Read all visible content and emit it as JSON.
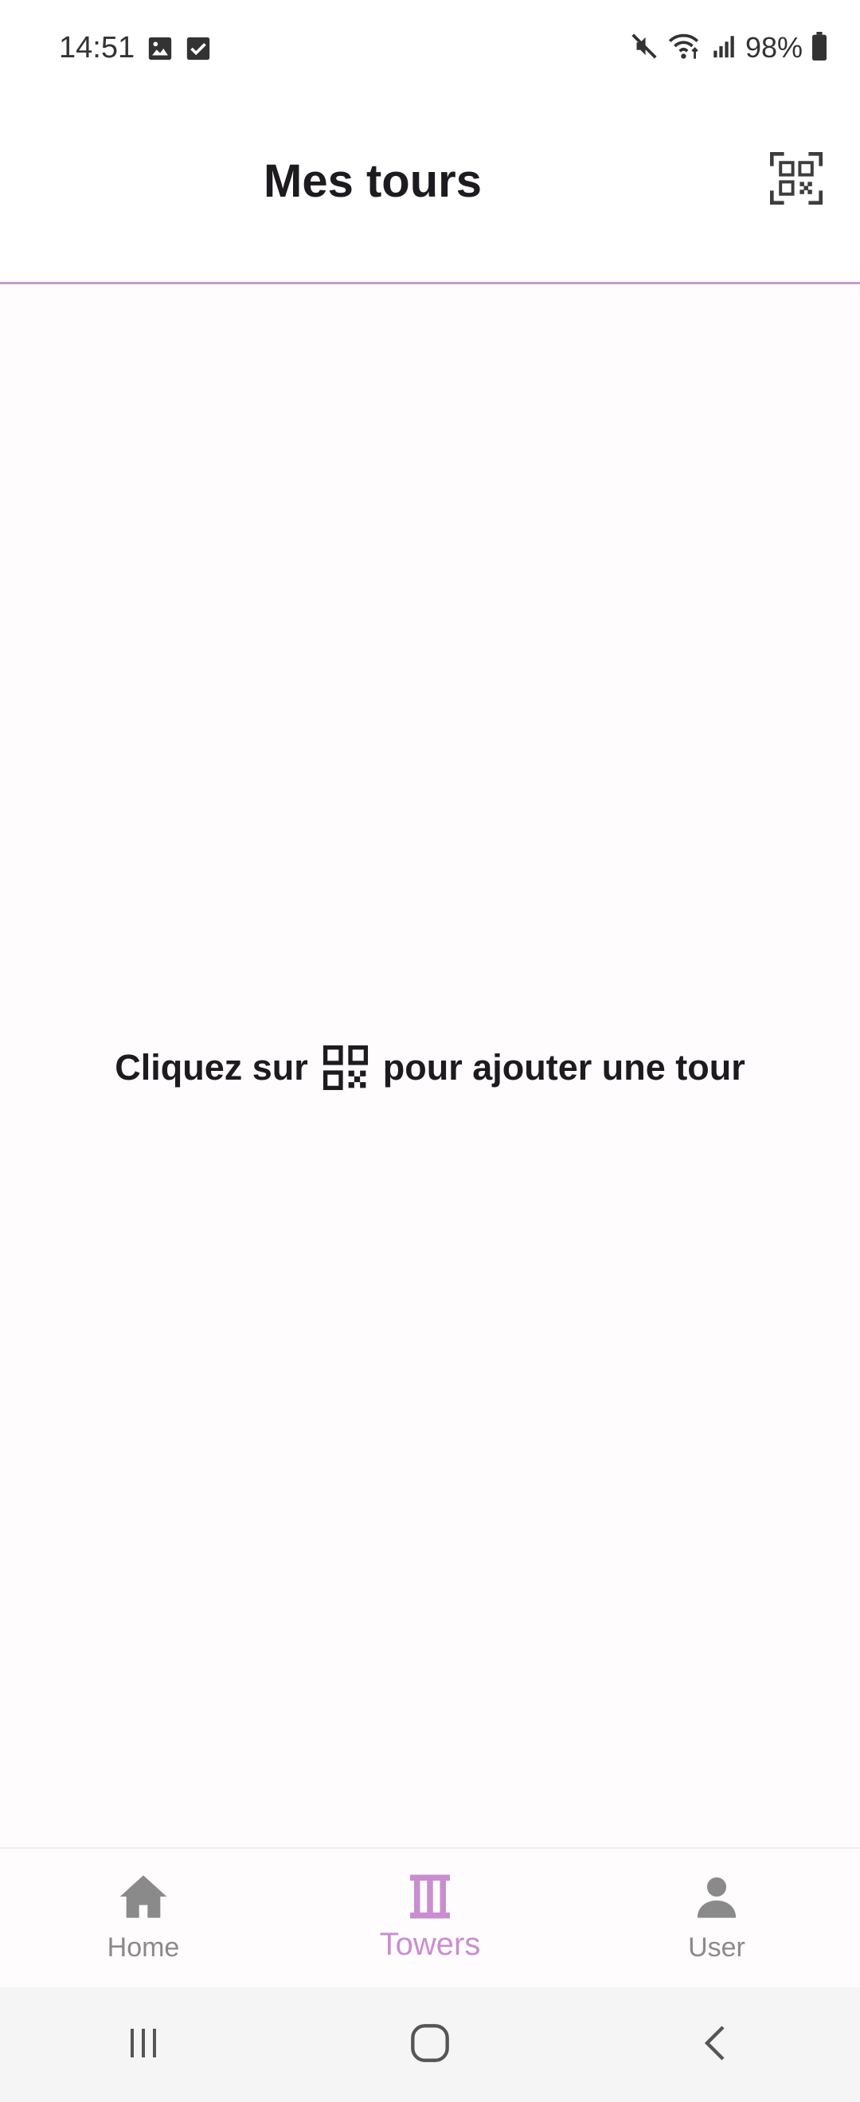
{
  "status_bar": {
    "time": "14:51",
    "battery_percent": "98%",
    "icons": [
      "gallery-notification-icon",
      "checkbox-notification-icon",
      "mute-icon",
      "wifi-icon",
      "signal-icon",
      "battery-icon"
    ]
  },
  "app_bar": {
    "title": "Mes tours",
    "scan_icon": "qr-scan-icon"
  },
  "content": {
    "hint_before": "Cliquez sur",
    "hint_after": "pour ajouter une tour",
    "hint_icon": "qr-code-icon"
  },
  "bottom_nav": {
    "items": [
      {
        "label": "Home",
        "icon": "home-icon",
        "active": false
      },
      {
        "label": "Towers",
        "icon": "tower-icon",
        "active": true
      },
      {
        "label": "User",
        "icon": "user-icon",
        "active": false
      }
    ]
  },
  "colors": {
    "accent": "#c98ed0",
    "divider": "#c99ad1",
    "inactive": "#8a8a8a",
    "text": "#1d1b20"
  },
  "system_nav": {
    "buttons": [
      "recent-apps-icon",
      "home-circle-icon",
      "back-icon"
    ]
  }
}
